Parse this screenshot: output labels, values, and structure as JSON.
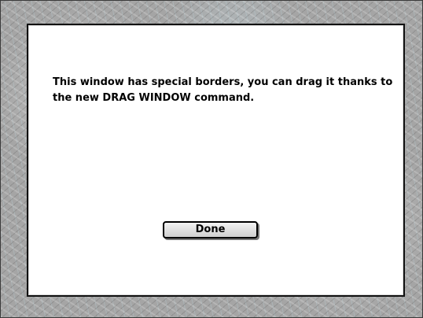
{
  "window": {
    "message": "This window has special borders, you can drag it thanks to the new DRAG WINDOW command.",
    "button_label": "Done"
  }
}
